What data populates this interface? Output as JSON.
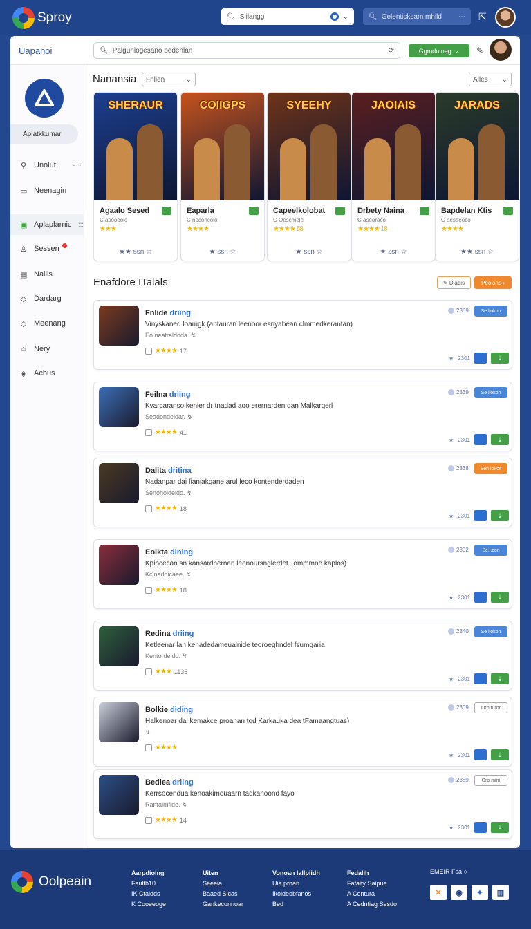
{
  "topbar": {
    "brand": "Sproy",
    "search_value": "Slilangg",
    "pill_text": "Gelenticksam mhild"
  },
  "panel": {
    "title": "Uapanoi",
    "search_placeholder": "Palguniogesano pedenlan",
    "green_button": "Ggmdn neg"
  },
  "sidebar": {
    "app_button": "Aplatkkumar",
    "items": [
      {
        "label": "Unolut",
        "icon": "search-icon"
      },
      {
        "label": "Neenagin",
        "icon": "document-icon"
      },
      {
        "label": "Aplaplarnic",
        "icon": "apps-icon"
      },
      {
        "label": "Sessen",
        "icon": "user-icon"
      },
      {
        "label": "Nallls",
        "icon": "news-icon"
      },
      {
        "label": "Dardarg",
        "icon": "tag-icon"
      },
      {
        "label": "Meenang",
        "icon": "tag-icon"
      },
      {
        "label": "Nery",
        "icon": "gift-icon"
      },
      {
        "label": "Acbus",
        "icon": "pin-icon"
      }
    ]
  },
  "featured": {
    "heading": "Nanansia",
    "filter": "Fnlien",
    "sort": "Alles",
    "cards": [
      {
        "art_title": "SHERAUR",
        "name": "Agaalo Sesed",
        "sub": "C asooeolo",
        "stars": "★★★",
        "rating": "★★ ssn ☆",
        "art": "#1d3f8f"
      },
      {
        "art_title": "COIIGPS",
        "name": "Eaparla",
        "sub": "C neconcolo",
        "stars": "★★★★",
        "rating": "★ ssn ☆",
        "art": "#c5531d"
      },
      {
        "art_title": "SYEEHY",
        "name": "Capeelkolobat",
        "sub": "C Oescmele",
        "stars": "★★★★ 58",
        "rating": "★ ssn ☆",
        "art": "#6e3318"
      },
      {
        "art_title": "JAOIAIS",
        "name": "Drbety Naina",
        "sub": "C aseoraco",
        "stars": "★★★★ 18",
        "rating": "★ ssn ☆",
        "art": "#5b1f1f"
      },
      {
        "art_title": "JARADS",
        "name": "Bapdelan Ktis",
        "sub": "C aeseeoco",
        "stars": "★★★★",
        "rating": "★★ ssn ☆",
        "art": "#2b3b2a"
      }
    ]
  },
  "listing": {
    "heading": "Enafdore ITalals",
    "sort_button": "Dladis",
    "primary_button": "Peolans",
    "rows": [
      {
        "title_a": "Fnlide",
        "title_b": "driing",
        "desc": "Vinyskaned loamgk (antauran leenoor esnyabean clmmedkerantan)",
        "sub": "Eo neatraldoda.",
        "stars": "★★★★",
        "count": "17",
        "meta": "2309",
        "btn": "Se llokon",
        "btn_style": "blue",
        "foot": "2301",
        "thumb": "#7b3b1e"
      },
      {
        "title_a": "Feilna",
        "title_b": "driing",
        "desc": "Kvarcaranso kenier dr tnadad aoo erernarden dan Malkargerl",
        "sub": "Seadondeldar.",
        "stars": "★★★★",
        "count": "41",
        "meta": "2339",
        "btn": "Se llokon",
        "btn_style": "blue",
        "foot": "2301",
        "thumb": "#3b6fb5"
      },
      {
        "title_a": "Dalita",
        "title_b": "dritina",
        "desc": "Nadanpar dai fianiakgane arul leco kontenderdaden",
        "sub": "Senoholdeldo.",
        "stars": "★★★★",
        "count": "18",
        "meta": "2338",
        "btn": "Sen lokos",
        "btn_style": "orange",
        "foot": "2301",
        "thumb": "#4a3a22"
      },
      {
        "title_a": "Eolkta",
        "title_b": "dining",
        "desc": "Kpiocecan sn kansardpernan leenoursnglerdet Tommmne kaplos)",
        "sub": "Kcinaddicaee.",
        "stars": "★★★★",
        "count": "18",
        "meta": "2302",
        "btn": "Se.l.con",
        "btn_style": "blue",
        "foot": "2301",
        "thumb": "#8a2d3a"
      },
      {
        "title_a": "Redina",
        "title_b": "driing",
        "desc": "Ketleenar lan kenadedameualnide teoroeghndel fsumgaria",
        "sub": "Kentordeldo.",
        "stars": "★★★",
        "count": "1135",
        "meta": "2340",
        "btn": "Se llokon",
        "btn_style": "blue",
        "foot": "2301",
        "thumb": "#2e5f3c"
      },
      {
        "title_a": "Bolkie",
        "title_b": "diding",
        "desc": "Halkenoar dal kemakce proanan tod Karkauka dea tFamaangtuas)",
        "sub": "",
        "stars": "★★★★",
        "count": "",
        "meta": "2309",
        "btn": "Oro turor",
        "btn_style": "outline",
        "foot": "2301",
        "thumb": "#c9cfd8"
      },
      {
        "title_a": "Bedlea",
        "title_b": "driing",
        "desc": "Kerrsocendua kenoakimouaarn tadkanoond fayo",
        "sub": "Ranfaimfide.",
        "stars": "★★★★",
        "count": "14",
        "meta": "2389",
        "btn": "Oro mim",
        "btn_style": "outline",
        "foot": "2301",
        "thumb": "#2c4f86"
      }
    ]
  },
  "footer": {
    "brand": "Oolpeain",
    "columns": [
      {
        "head": "Aarpdioing",
        "items": [
          "Faultb10",
          "IK Ctaidds",
          "K Cooeeoge"
        ]
      },
      {
        "head": "Uiten",
        "items": [
          "Seeeia",
          "Baaed Sicas",
          "Gankeconnoar"
        ]
      },
      {
        "head": "Vonoan Iallpiidh",
        "items": [
          "Uia prnan",
          "Ikoldeobfanos",
          "Bed"
        ]
      },
      {
        "head": "Fedalih",
        "items": [
          "Fafaity Saipue",
          "A Centura",
          "A Cedntiag Sesdo"
        ]
      }
    ],
    "social_head": "EMEIR Fsa"
  }
}
